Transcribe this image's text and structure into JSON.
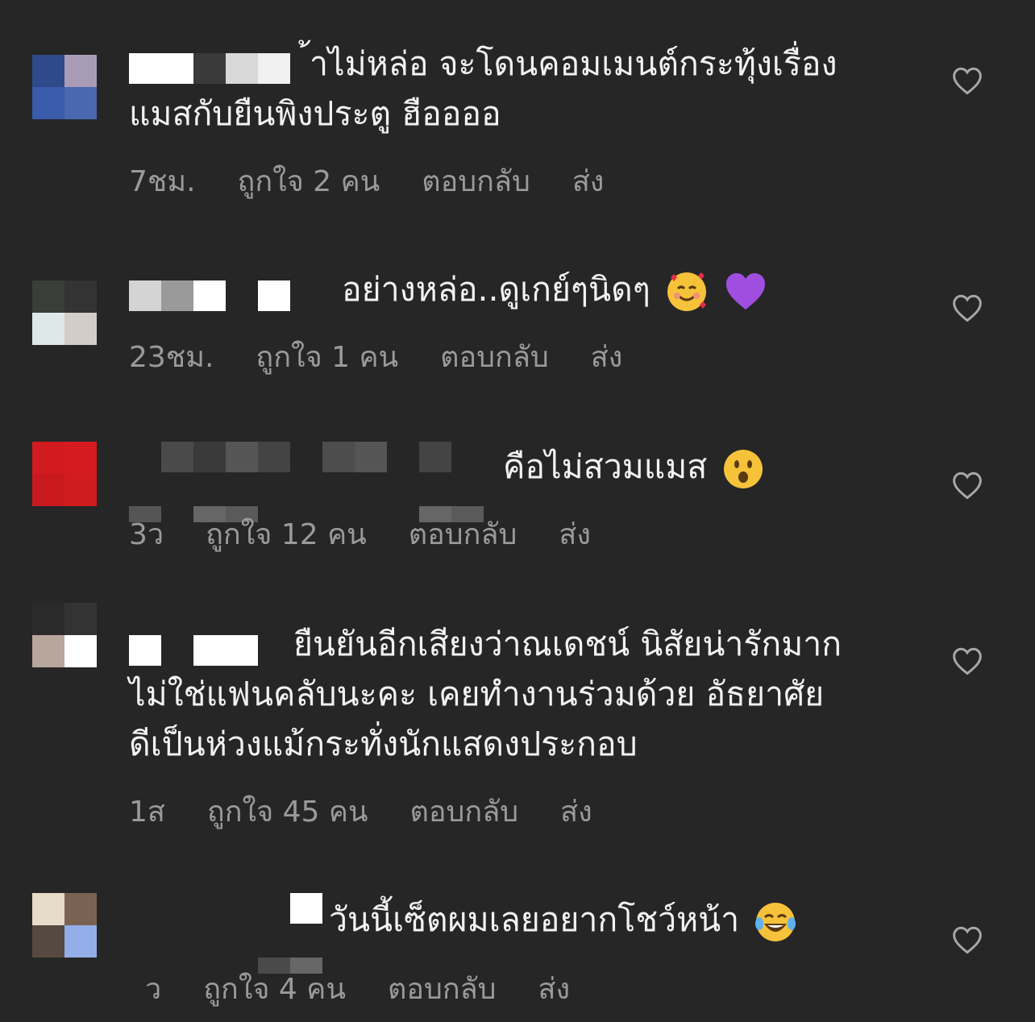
{
  "comments": [
    {
      "text_lines": [
        "้าไม่หล่อ จะโดนคอมเมนต์กระทุ้งเรื่อง",
        "แมสกับยืนพิงประตู ฮืออออ"
      ],
      "time": "7ชม.",
      "likes": "ถูกใจ 2 คน",
      "reply": "ตอบกลับ",
      "send": "ส่ง"
    },
    {
      "text_lines": [
        "อย่างหล่อ..ดูเกย์ๆนิดๆ"
      ],
      "emojis": [
        "smiling-face-with-hearts-emoji",
        "purple-heart-emoji"
      ],
      "time": "23ชม.",
      "likes": "ถูกใจ 1 คน",
      "reply": "ตอบกลับ",
      "send": "ส่ง"
    },
    {
      "text_lines": [
        "คือไม่สวมแมส"
      ],
      "emojis": [
        "surprised-face-emoji"
      ],
      "time": "3ว",
      "likes": "ถูกใจ 12 คน",
      "reply": "ตอบกลับ",
      "send": "ส่ง"
    },
    {
      "text_lines": [
        "ยืนยันอีกเสียงว่าณเดชน์ นิสัยน่ารักมาก",
        "ไม่ใช่แฟนคลับนะคะ เคยทำงานร่วมด้วย อัธยาศัย",
        "ดีเป็นห่วงแม้กระทั่งนักแสดงประกอบ"
      ],
      "time": "1ส",
      "likes": "ถูกใจ 45 คน",
      "reply": "ตอบกลับ",
      "send": "ส่ง"
    },
    {
      "text_lines": [
        "วันนี้เซ็ตผมเลยอยากโชว์หน้า"
      ],
      "emojis": [
        "tears-of-joy-emoji"
      ],
      "time": "ว",
      "likes": "ถูกใจ 4 คน",
      "reply": "ตอบกลับ",
      "send": "ส่ง"
    }
  ],
  "colors": {
    "background": "#262626",
    "text": "#f2f2f2",
    "meta": "#9a9a9a"
  }
}
